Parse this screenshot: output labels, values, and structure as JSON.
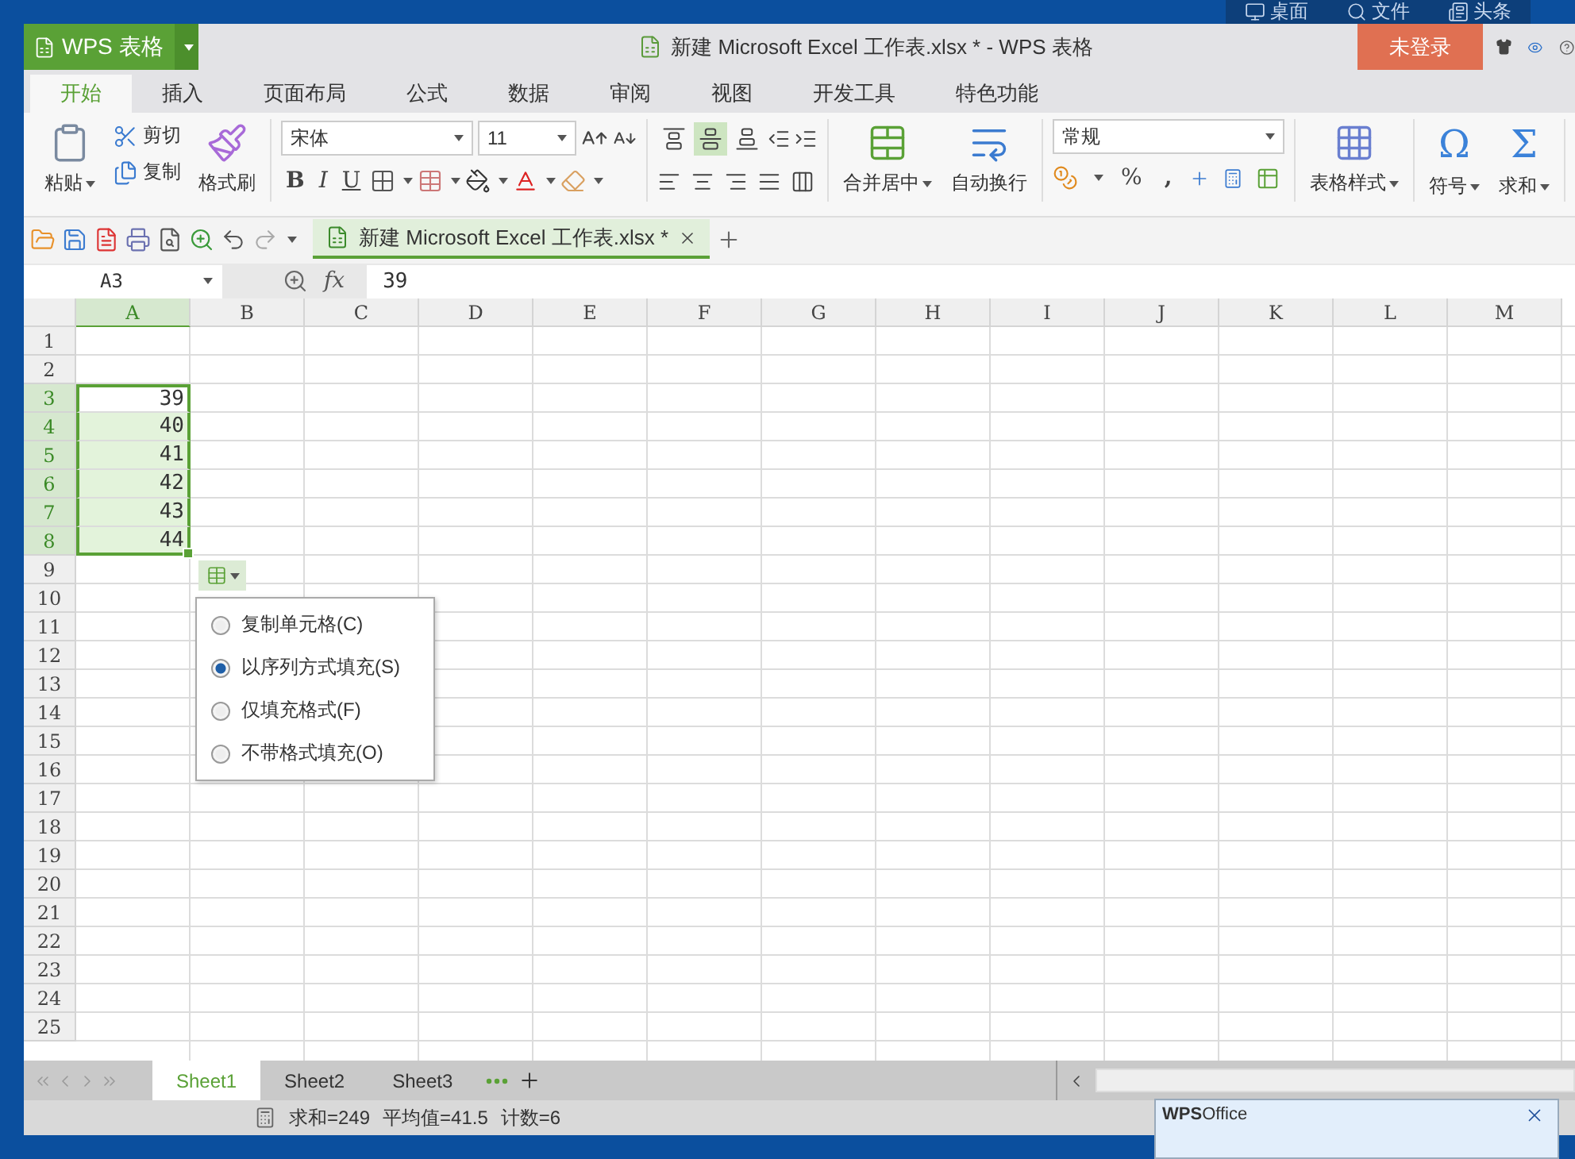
{
  "desktop_bar": [
    {
      "label": "桌面"
    },
    {
      "label": "文件"
    },
    {
      "label": "头条"
    }
  ],
  "window": {
    "app_button": "WPS 表格",
    "title": "新建 Microsoft Excel 工作表.xlsx * - WPS 表格",
    "login_button": "未登录"
  },
  "ribbon_tabs": [
    {
      "label": "开始",
      "selected": true
    },
    {
      "label": "插入",
      "selected": false
    },
    {
      "label": "页面布局",
      "selected": false
    },
    {
      "label": "公式",
      "selected": false
    },
    {
      "label": "数据",
      "selected": false
    },
    {
      "label": "审阅",
      "selected": false
    },
    {
      "label": "视图",
      "selected": false
    },
    {
      "label": "开发工具",
      "selected": false
    },
    {
      "label": "特色功能",
      "selected": false
    }
  ],
  "ribbon": {
    "paste": "粘贴",
    "cut": "剪切",
    "copy": "复制",
    "format_painter": "格式刷",
    "font_name": "宋体",
    "font_size": "11",
    "bold": "B",
    "italic": "I",
    "underline": "U",
    "vertical_align": [
      {
        "selected": false
      },
      {
        "selected": true
      },
      {
        "selected": false
      }
    ],
    "merge_center": "合并居中",
    "wrap_text": "自动换行",
    "number_format": "常规",
    "percent": "%",
    "comma": ",",
    "table_style": "表格样式",
    "symbol_glyph": "Ω",
    "symbol": "符号",
    "sum_glyph": "Σ",
    "sum": "求和"
  },
  "doc_tab": {
    "label": "新建 Microsoft Excel 工作表.xlsx *"
  },
  "formula_bar": {
    "name_box": "A3",
    "fx": "fx",
    "value": "39"
  },
  "sheet": {
    "columns": [
      {
        "label": "A",
        "selected": true
      },
      {
        "label": "B",
        "selected": false
      },
      {
        "label": "C",
        "selected": false
      },
      {
        "label": "D",
        "selected": false
      },
      {
        "label": "E",
        "selected": false
      },
      {
        "label": "F",
        "selected": false
      },
      {
        "label": "G",
        "selected": false
      },
      {
        "label": "H",
        "selected": false
      },
      {
        "label": "I",
        "selected": false
      },
      {
        "label": "J",
        "selected": false
      },
      {
        "label": "K",
        "selected": false
      },
      {
        "label": "L",
        "selected": false
      },
      {
        "label": "M",
        "selected": false
      }
    ],
    "rows": [
      {
        "header": "1",
        "selected": false
      },
      {
        "header": "2",
        "selected": false
      },
      {
        "header": "3",
        "selected": true,
        "a": "39",
        "active": true
      },
      {
        "header": "4",
        "selected": true,
        "a": "40",
        "active": false
      },
      {
        "header": "5",
        "selected": true,
        "a": "41",
        "active": false
      },
      {
        "header": "6",
        "selected": true,
        "a": "42",
        "active": false
      },
      {
        "header": "7",
        "selected": true,
        "a": "43",
        "active": false
      },
      {
        "header": "8",
        "selected": true,
        "a": "44",
        "active": false
      },
      {
        "header": "9",
        "selected": false
      },
      {
        "header": "10",
        "selected": false
      },
      {
        "header": "11",
        "selected": false
      },
      {
        "header": "12",
        "selected": false
      },
      {
        "header": "13",
        "selected": false
      },
      {
        "header": "14",
        "selected": false
      },
      {
        "header": "15",
        "selected": false
      },
      {
        "header": "16",
        "selected": false
      },
      {
        "header": "17",
        "selected": false
      },
      {
        "header": "18",
        "selected": false
      },
      {
        "header": "19",
        "selected": false
      },
      {
        "header": "20",
        "selected": false
      },
      {
        "header": "21",
        "selected": false
      },
      {
        "header": "22",
        "selected": false
      },
      {
        "header": "23",
        "selected": false
      },
      {
        "header": "24",
        "selected": false
      },
      {
        "header": "25",
        "selected": false
      }
    ]
  },
  "fill_menu": [
    {
      "label": "复制单元格(C)",
      "selected": false
    },
    {
      "label": "以序列方式填充(S)",
      "selected": true
    },
    {
      "label": "仅填充格式(F)",
      "selected": false
    },
    {
      "label": "不带格式填充(O)",
      "selected": false
    }
  ],
  "sheet_tabs": [
    {
      "label": "Sheet1",
      "selected": true
    },
    {
      "label": "Sheet2",
      "selected": false
    },
    {
      "label": "Sheet3",
      "selected": false
    }
  ],
  "status_bar": [
    "求和=249",
    "平均值=41.5",
    "计数=6"
  ],
  "notification": {
    "title": "**WPS**Office"
  }
}
